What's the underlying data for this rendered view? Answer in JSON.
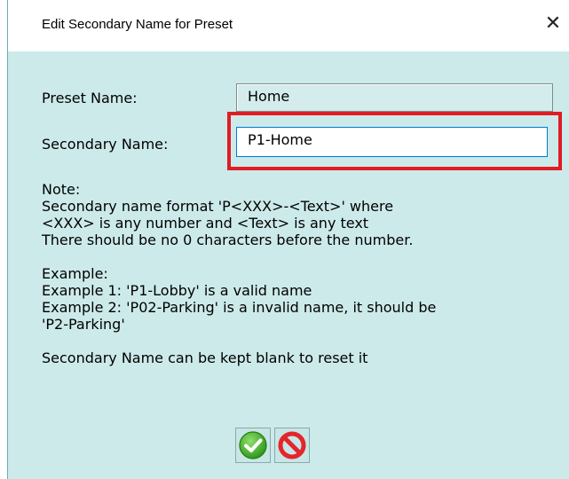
{
  "window": {
    "title": "Edit Secondary Name for Preset",
    "close_glyph": "✕"
  },
  "form": {
    "preset_name_label": "Preset Name:",
    "preset_name_value": "Home",
    "secondary_name_label": "Secondary Name:",
    "secondary_name_value": "P1-Home"
  },
  "note": {
    "lines": [
      "Note:",
      "Secondary name format 'P<XXX>-<Text>' where",
      "<XXX> is any number and <Text> is any text",
      "There should be no 0 characters before the number.",
      "",
      "Example:",
      "Example 1: 'P1-Lobby' is a valid name",
      "Example 2: 'P02-Parking' is a invalid name, it should be",
      "'P2-Parking'",
      "",
      "Secondary Name can be kept blank to reset it"
    ]
  },
  "buttons": {
    "ok_icon": "check-icon",
    "cancel_icon": "prohibited-icon"
  },
  "colors": {
    "dialog_background": "#cdeaea",
    "highlight_border": "#e01c24",
    "ok_green": "#4cbb2e",
    "cancel_red": "#e3262c"
  }
}
